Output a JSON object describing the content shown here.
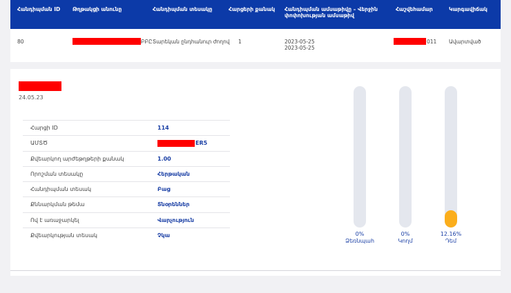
{
  "table": {
    "headers": [
      "Հանդիպման ID",
      "Թղթակցի անունը",
      "Հանդիպման տեսակը",
      "Հարցերի քանակ",
      "Հանդիպման ամսաթիվը – Վերջին փոփոխության ամսաթիվ",
      "Հաշվեհամար",
      "Կարգավիճակ"
    ],
    "row": {
      "id": "80",
      "name_suffix": "ԲԲԸ",
      "type": "Տարեկան ընդհանուր ժողով",
      "questions": "1",
      "date_meeting": "2023-05-25",
      "date_modified": "2023-05-25",
      "account_suffix": "011",
      "status": "Ավարտված"
    }
  },
  "detail": {
    "date": "24.05.23",
    "rows": [
      {
        "label": "Հարցի ID",
        "value": "114"
      },
      {
        "label": "ԱՄՏԾ",
        "value": "ER5"
      },
      {
        "label": "Քվեարկող արժեթղթերի քանակ",
        "value": "1.00"
      },
      {
        "label": "Որոշման տեսակը",
        "value": "Հերթական"
      },
      {
        "label": "Հանդիպման տեսակ",
        "value": "Բաց"
      },
      {
        "label": "Քննարկման թեմա",
        "value": "Տնօրեններ"
      },
      {
        "label": "Ով է առաջարկել",
        "value": "Վարչություն"
      },
      {
        "label": "Քվեարկության տեսակ",
        "value": "Չկա"
      }
    ],
    "bars": [
      {
        "percent": "0%",
        "label": "Ձեռնպահ",
        "fill": 0
      },
      {
        "percent": "0%",
        "label": "Կողմ",
        "fill": 0
      },
      {
        "percent": "12.16%",
        "label": "Դեմ",
        "fill": 0.1216
      }
    ]
  },
  "colors": {
    "header_bg": "#0c3aa8",
    "accent": "#1a3fa5",
    "bar_fill": "#fbae1c",
    "redaction": "#ff0000"
  }
}
